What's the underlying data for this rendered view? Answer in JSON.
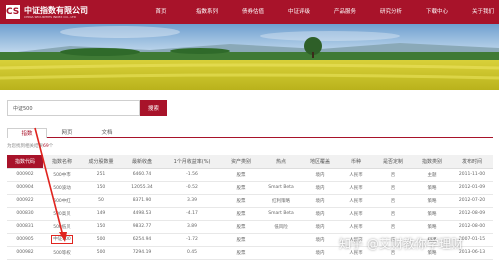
{
  "header": {
    "logo_mark": "CSI",
    "logo_cn": "中证指数有限公司",
    "logo_en": "CHINA SECURITIES INDEX CO., LTD",
    "nav": [
      "首页",
      "指数系列",
      "债券估值",
      "中证评级",
      "产品服务",
      "研究分析",
      "下载中心",
      "关于我们"
    ]
  },
  "search": {
    "value": "中证500",
    "button_label": "搜索"
  },
  "tabs": [
    "指数",
    "网页",
    "文档"
  ],
  "result": {
    "prefix": "为您找到相关结果",
    "count": "69",
    "suffix": "个"
  },
  "table": {
    "headers": [
      "指数代码",
      "指数名称",
      "成分股数量",
      "最新收盘",
      "1个月收益率(%)",
      "资产类别",
      "热点",
      "地区覆盖",
      "币种",
      "是否定制",
      "指数类别",
      "发布时间"
    ],
    "rows": [
      [
        "000902",
        "500中市",
        "251",
        "6460.74",
        "-1.56",
        "股票",
        "",
        "境内",
        "人民币",
        "否",
        "主题",
        "2011-11-00"
      ],
      [
        "000904",
        "500波动",
        "150",
        "12055.34",
        "-0.52",
        "股票",
        "Smart Beta",
        "境内",
        "人民币",
        "否",
        "策略",
        "2012-01-09"
      ],
      [
        "000922",
        "500中红",
        "50",
        "8371.90",
        "3.39",
        "股票",
        "红利策略",
        "境内",
        "人民币",
        "否",
        "策略",
        "2012-07-20"
      ],
      [
        "000830",
        "500高贝",
        "149",
        "4498.53",
        "-4.17",
        "股票",
        "Smart Beta",
        "境内",
        "人民币",
        "否",
        "策略",
        "2012-08-09"
      ],
      [
        "000831",
        "500低贝",
        "150",
        "9832.77",
        "3.89",
        "股票",
        "低风险",
        "境内",
        "人民币",
        "否",
        "策略",
        "2012-08-00"
      ],
      [
        "000905",
        "中证500",
        "500",
        "6254.94",
        "-1.72",
        "股票",
        "",
        "境内",
        "人民币",
        "否",
        "规模",
        "2007-01-15"
      ],
      [
        "000982",
        "500等权",
        "500",
        "7294.19",
        "0.45",
        "股票",
        "",
        "境内",
        "人民币",
        "否",
        "策略",
        "2013-06-13"
      ]
    ]
  },
  "watermark": "知乎 @艾财教你学理财",
  "colors": {
    "brand": "#a8132a",
    "highlight": "#e0241f"
  }
}
